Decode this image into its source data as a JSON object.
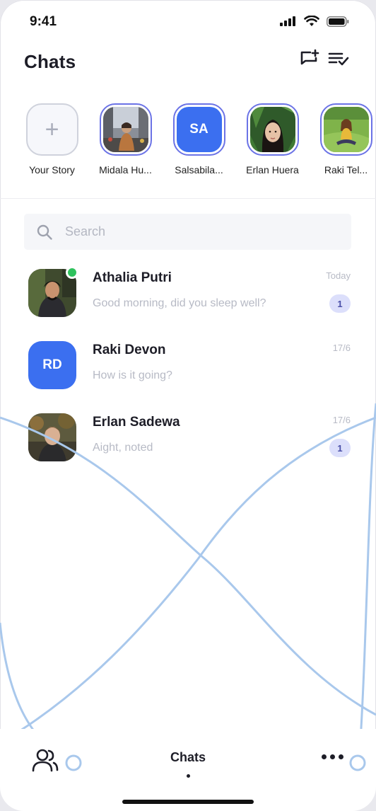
{
  "status": {
    "time": "9:41"
  },
  "header": {
    "title": "Chats"
  },
  "stories": [
    {
      "name": "Your Story",
      "type": "add"
    },
    {
      "name": "Midala Hu...",
      "type": "photo",
      "photo": "city-street"
    },
    {
      "name": "Salsabila...",
      "type": "initials",
      "initials": "SA"
    },
    {
      "name": "Erlan Huera",
      "type": "photo",
      "photo": "portrait-leaves"
    },
    {
      "name": "Raki Tel...",
      "type": "photo",
      "photo": "grass-field"
    }
  ],
  "search": {
    "placeholder": "Search"
  },
  "chats": [
    {
      "name": "Athalia Putri",
      "message": "Good morning, did you sleep well?",
      "time": "Today",
      "unread": "1",
      "online": true,
      "avatar": "photo"
    },
    {
      "name": "Raki Devon",
      "message": "How is it going?",
      "time": "17/6",
      "unread": "",
      "online": false,
      "avatar": "initials",
      "initials": "RD"
    },
    {
      "name": "Erlan Sadewa",
      "message": "Aight, noted",
      "time": "17/6",
      "unread": "1",
      "online": false,
      "avatar": "photo"
    }
  ],
  "bottom_nav": {
    "active_label": "Chats"
  },
  "colors": {
    "accent": "#3b6ff0",
    "ring": "#6b73e6",
    "online": "#2fc25d",
    "badge_bg": "#dcdffb",
    "deco_line": "#a9c8ec"
  },
  "icons": [
    "signal-icon",
    "wifi-icon",
    "battery-icon",
    "new-chat-icon",
    "filter-list-icon",
    "search-icon",
    "contacts-icon",
    "more-dots-icon",
    "plus-icon"
  ]
}
